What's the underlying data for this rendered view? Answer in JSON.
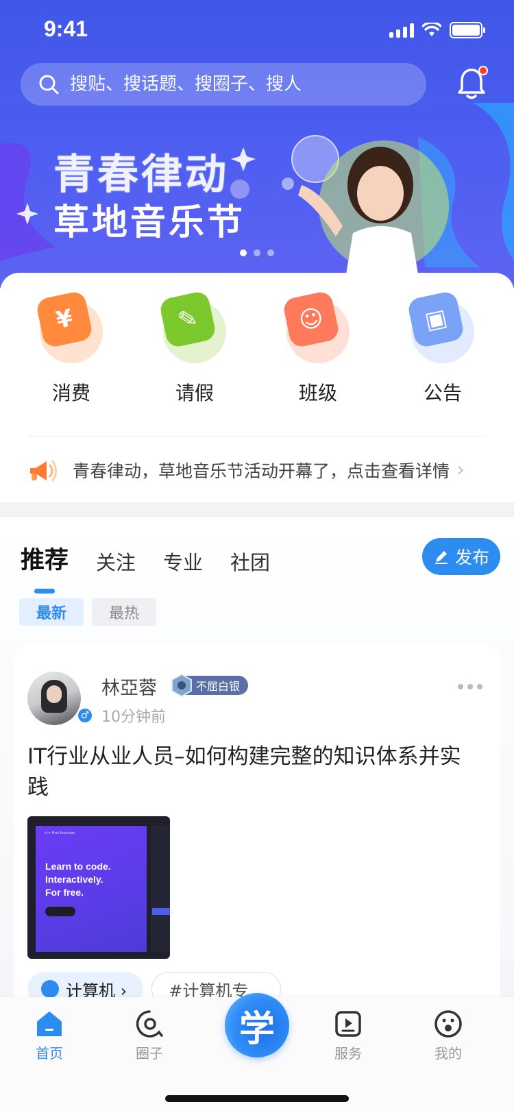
{
  "status": {
    "time": "9:41"
  },
  "search": {
    "placeholder": "搜贴、搜话题、搜圈子、搜人"
  },
  "banner": {
    "title_line1": "青春律动",
    "title_line2": "草地音乐节"
  },
  "quick_actions": [
    {
      "label": "消费",
      "icon": "wallet-coin-icon",
      "color": "#ff8a3d"
    },
    {
      "label": "请假",
      "icon": "leave-note-icon",
      "color": "#7bc92c"
    },
    {
      "label": "班级",
      "icon": "class-people-icon",
      "color": "#ff7a5a"
    },
    {
      "label": "公告",
      "icon": "announcement-book-icon",
      "color": "#7aa3f8"
    }
  ],
  "notice": {
    "text": "青春律动，草地音乐节活动开幕了，点击查看详情"
  },
  "feed": {
    "tabs": [
      "推荐",
      "关注",
      "专业",
      "社团"
    ],
    "publish_label": "发布",
    "filters": [
      "最新",
      "最热"
    ],
    "post": {
      "author": "林亞蓉",
      "rank": "不屈白银",
      "time": "10分钟前",
      "title": "IT行业从业人员–如何构建完整的知识体系并实践",
      "image_text": {
        "brand": "</> First Brackets",
        "headline": "Learn to code.\nInteractively.\nFor free."
      },
      "tags": [
        "计算机 ›",
        "#计算机专..."
      ]
    }
  },
  "bottom_nav": [
    {
      "label": "首页",
      "icon": "home-icon",
      "active": true
    },
    {
      "label": "圈子",
      "icon": "circle-chat-icon",
      "active": false
    },
    {
      "label": "学",
      "icon": "learn-center-icon",
      "active": false
    },
    {
      "label": "服务",
      "icon": "service-play-icon",
      "active": false
    },
    {
      "label": "我的",
      "icon": "profile-face-icon",
      "active": false
    }
  ],
  "colors": {
    "primary": "#2d8cf0",
    "header": "#4b5df0"
  }
}
